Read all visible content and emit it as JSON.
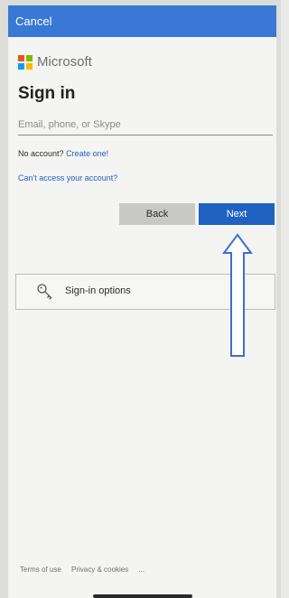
{
  "topbar": {
    "cancel_label": "Cancel"
  },
  "brand": {
    "name": "Microsoft"
  },
  "signin": {
    "title": "Sign in",
    "email_placeholder": "Email, phone, or Skype",
    "email_value": "",
    "no_account_text": "No account?",
    "create_link": "Create one!",
    "cant_access": "Can't access your account?",
    "back_label": "Back",
    "next_label": "Next",
    "options_label": "Sign-in options"
  },
  "footer": {
    "terms": "Terms of use",
    "privacy": "Privacy & cookies",
    "more": "..."
  },
  "colors": {
    "topbar": "#3a78d6",
    "primary_button": "#1f62c2",
    "link": "#1f62c2",
    "secondary_button": "#c8c8c6"
  },
  "icons": {
    "logo": "microsoft-logo-icon",
    "options": "key-icon",
    "annotation": "up-arrow-icon"
  }
}
